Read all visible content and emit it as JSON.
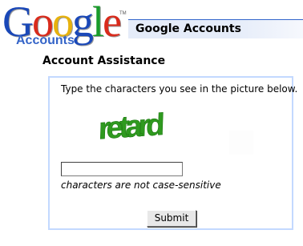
{
  "logo": {
    "google_letters": [
      {
        "char": "G",
        "color": "#1a48b8"
      },
      {
        "char": "o",
        "color": "#d92b1c"
      },
      {
        "char": "o",
        "color": "#e7b20d"
      },
      {
        "char": "g",
        "color": "#1a48b8"
      },
      {
        "char": "l",
        "color": "#189c2a"
      },
      {
        "char": "e",
        "color": "#d92b1c"
      }
    ],
    "google_text": "Google",
    "trademark": "TM",
    "accounts": "Accounts"
  },
  "header": {
    "title": "Google Accounts",
    "bar_color": "#e5ecf9",
    "rule_color": "#3366cc"
  },
  "page": {
    "title": "Account Assistance"
  },
  "form": {
    "instructions": "Type the characters you see in the picture below.",
    "captcha_word": "retard",
    "captcha_color": "#2f9a1f",
    "answer_value": "",
    "hint": "characters are not case-sensitive",
    "submit_label": "Submit",
    "panel_border_color": "#c3d9ff"
  }
}
